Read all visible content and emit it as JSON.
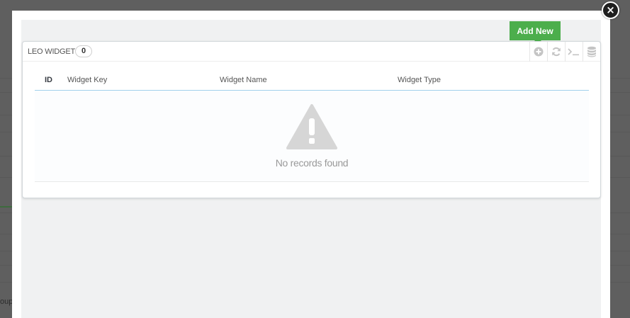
{
  "background": {
    "partial_text": "oup"
  },
  "modal": {
    "close_label": "×",
    "add_new_label": "Add New",
    "panel": {
      "title": "LEO WIDGETS",
      "count": "0",
      "tools": [
        {
          "name": "add-circle-icon"
        },
        {
          "name": "refresh-icon"
        },
        {
          "name": "terminal-icon"
        },
        {
          "name": "database-icon"
        }
      ]
    },
    "table": {
      "columns": [
        "ID",
        "Widget Key",
        "Widget Name",
        "Widget Type"
      ],
      "empty_message": "No records found"
    }
  },
  "colors": {
    "accent_green": "#4cae4c",
    "header_border": "#a0d0eb",
    "muted_icon": "#cccccc"
  }
}
